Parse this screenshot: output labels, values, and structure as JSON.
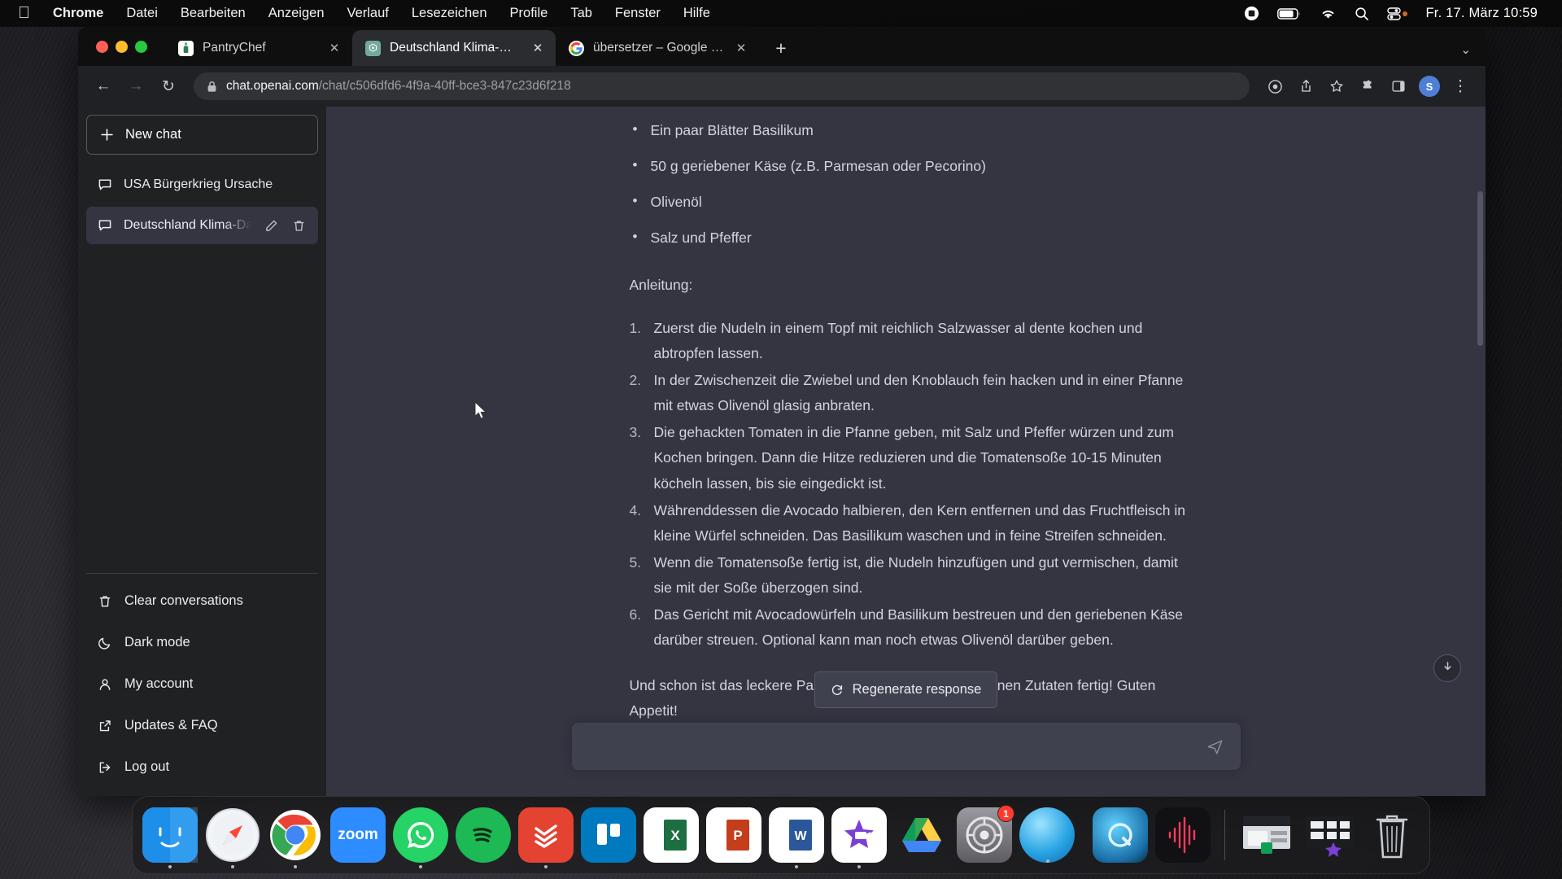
{
  "menubar": {
    "apple_logo": "",
    "items": [
      {
        "label": "Chrome",
        "bold": true
      },
      {
        "label": "Datei",
        "bold": false
      },
      {
        "label": "Bearbeiten",
        "bold": false
      },
      {
        "label": "Anzeigen",
        "bold": false
      },
      {
        "label": "Verlauf",
        "bold": false
      },
      {
        "label": "Lesezeichen",
        "bold": false
      },
      {
        "label": "Profile",
        "bold": false
      },
      {
        "label": "Tab",
        "bold": false
      },
      {
        "label": "Fenster",
        "bold": false
      },
      {
        "label": "Hilfe",
        "bold": false
      }
    ],
    "status": {
      "screen_recording_icon": "record-icon",
      "battery_icon": "battery-icon",
      "wifi_icon": "wifi-icon",
      "search_icon": "spotlight-search-icon",
      "control_center_icon": "control-center-icon",
      "clock": "Fr. 17. März  10:59"
    }
  },
  "browser": {
    "tabs": [
      {
        "title": "PantryChef",
        "favicon": "pantrychef-icon",
        "active": false,
        "close": "✕"
      },
      {
        "title": "Deutschland Klima-Daten.",
        "favicon": "chatgpt-icon",
        "active": true,
        "close": "✕"
      },
      {
        "title": "übersetzer – Google Suche",
        "favicon": "google-icon",
        "active": false,
        "close": "✕"
      }
    ],
    "new_tab_label": "+",
    "tab_list_chevron": "⌄",
    "toolbar": {
      "back": "←",
      "forward": "→",
      "reload": "↻",
      "lock_icon": "lock-icon",
      "url_host": "chat.openai.com",
      "url_path": "/chat/c506dfd6-4f9a-40ff-bce3-847c23d6f218",
      "url_full": "chat.openai.com/chat/c506dfd6-4f9a-40ff-bce3-847c23d6f218",
      "extensions_label": "☰",
      "share_icon": "share-icon",
      "bookmark_icon": "star-icon",
      "puzzle_icon": "extensions-icon",
      "sidepanel_icon": "side-panel-icon",
      "profile_initial": "S",
      "menu_icon": "⋮"
    }
  },
  "sidebar": {
    "new_chat": {
      "label": "New chat",
      "icon": "plus-icon"
    },
    "conversations": [
      {
        "label": "USA Bürgerkrieg Ursache",
        "icon": "chat-bubble-icon",
        "selected": false
      },
      {
        "label": "Deutschland Klima-Daten.",
        "icon": "chat-bubble-icon",
        "selected": true,
        "edit_icon": "pencil-icon",
        "delete_icon": "trash-icon"
      }
    ],
    "menu": [
      {
        "label": "Clear conversations",
        "icon": "trash-icon"
      },
      {
        "label": "Dark mode",
        "icon": "moon-icon"
      },
      {
        "label": "My account",
        "icon": "user-icon"
      },
      {
        "label": "Updates & FAQ",
        "icon": "external-link-icon"
      },
      {
        "label": "Log out",
        "icon": "logout-icon"
      }
    ]
  },
  "conversation": {
    "ingredients": [
      "Ein paar Blätter Basilikum",
      "50 g geriebener Käse (z.B. Parmesan oder Pecorino)",
      "Olivenöl",
      "Salz und Pfeffer"
    ],
    "instructions_heading": "Anleitung:",
    "steps": [
      "Zuerst die Nudeln in einem Topf mit reichlich Salzwasser al dente kochen und abtropfen lassen.",
      "In der Zwischenzeit die Zwiebel und den Knoblauch fein hacken und in einer Pfanne mit etwas Olivenöl glasig anbraten.",
      "Die gehackten Tomaten in die Pfanne geben, mit Salz und Pfeffer würzen und zum Kochen bringen. Dann die Hitze reduzieren und die Tomatensoße 10-15 Minuten köcheln lassen, bis sie eingedickt ist.",
      "Währenddessen die Avocado halbieren, den Kern entfernen und das Fruchtfleisch in kleine Würfel schneiden. Das Basilikum waschen und in feine Streifen schneiden.",
      "Wenn die Tomatensoße fertig ist, die Nudeln hinzufügen und gut vermischen, damit sie mit der Soße überzogen sind.",
      "Das Gericht mit Avocadowürfeln und Basilikum bestreuen und den geriebenen Käse darüber streuen. Optional kann man noch etwas Olivenöl darüber geben."
    ],
    "closing": "Und schon ist das leckere Pasta-Gericht mit den vorhandenen Zutaten fertig! Guten Appetit!",
    "regenerate_label": "Regenerate response",
    "regenerate_icon": "refresh-icon",
    "scroll_to_bottom_icon": "arrow-down-icon",
    "composer_placeholder": "",
    "composer_value": "",
    "send_icon": "send-icon"
  },
  "dock": {
    "items": [
      {
        "name": "finder",
        "label": "",
        "glyph": "☺",
        "bg": "linear-gradient(180deg,#3ea9f5,#1a7ee0)",
        "running": true
      },
      {
        "name": "safari",
        "label": "",
        "glyph": "✦",
        "bg": "radial-gradient(circle at 50% 50%,#f7f7f9,#cfd6dd)",
        "running": true
      },
      {
        "name": "google-chrome",
        "label": "",
        "glyph": "",
        "bg": "#ffffff",
        "running": true
      },
      {
        "name": "zoom",
        "label": "zoom",
        "glyph": "",
        "bg": "#2d8cff",
        "running": false
      },
      {
        "name": "whatsapp",
        "label": "",
        "glyph": "✆",
        "bg": "#25d366",
        "running": true
      },
      {
        "name": "spotify",
        "label": "",
        "glyph": "≈",
        "bg": "#1db954",
        "running": false
      },
      {
        "name": "todoist",
        "label": "",
        "glyph": "✓",
        "bg": "#e44332",
        "running": true
      },
      {
        "name": "trello",
        "label": "",
        "glyph": "◫",
        "bg": "#0079bf",
        "running": false
      },
      {
        "name": "microsoft-excel",
        "label": "X",
        "glyph": "",
        "bg": "#ffffff",
        "running": false
      },
      {
        "name": "microsoft-powerpoint",
        "label": "P",
        "glyph": "",
        "bg": "#ffffff",
        "running": false
      },
      {
        "name": "microsoft-word",
        "label": "W",
        "glyph": "",
        "bg": "#ffffff",
        "running": true
      },
      {
        "name": "imovie",
        "label": "",
        "glyph": "★",
        "bg": "#ffffff",
        "running": true
      },
      {
        "name": "google-drive",
        "label": "",
        "glyph": "△",
        "bg": "#ffffff",
        "running": false
      },
      {
        "name": "system-settings",
        "label": "",
        "glyph": "⚙",
        "bg": "linear-gradient(180deg,#8e8e93,#5a5a5f)",
        "running": false,
        "badge": "1"
      },
      {
        "name": "blue-orb-app",
        "label": "",
        "glyph": "",
        "bg": "radial-gradient(circle at 38% 32%,#7fd8ff,#1f9fe0 60%,#0b6fb5)",
        "running": true
      },
      {
        "name": "quicktime-player",
        "label": "",
        "glyph": "◔",
        "bg": "radial-gradient(circle at 40% 35%,#5fd0ff,#1a6fa8 70%,#08354f)",
        "running": false
      },
      {
        "name": "audio-waveform-app",
        "label": "",
        "glyph": "⌇",
        "bg": "#111114",
        "running": false
      }
    ],
    "stacks": [
      {
        "name": "downloads-stack",
        "label": ""
      },
      {
        "name": "documents-stack",
        "label": ""
      }
    ],
    "trash": {
      "name": "trash",
      "label": ""
    }
  }
}
